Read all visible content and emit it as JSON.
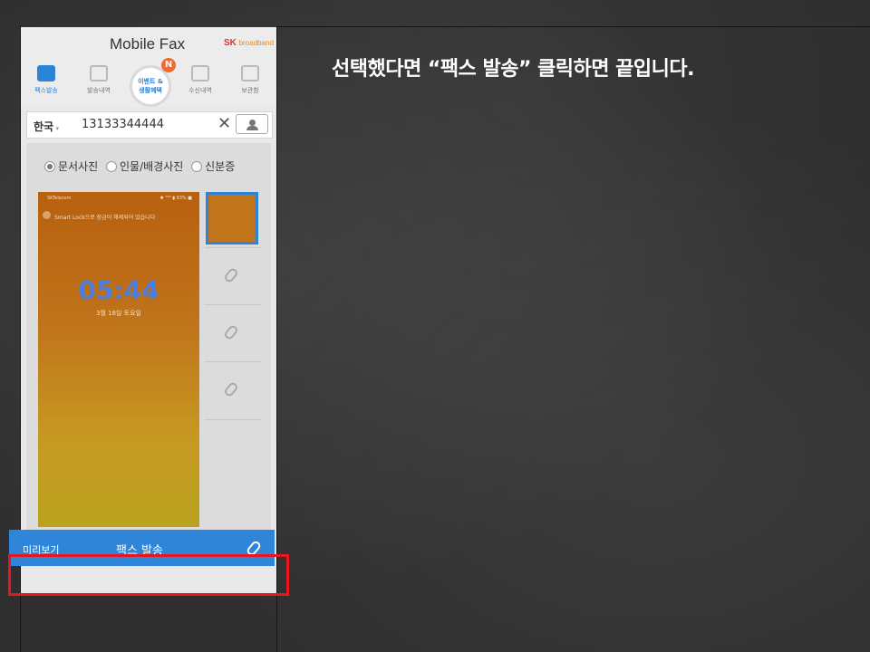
{
  "caption": "선택했다면 “팩스 발송” 클릭하면 끝입니다.",
  "app": {
    "title": "Mobile Fax",
    "brand": "SK",
    "brand_sub": "broadband"
  },
  "nav": [
    {
      "label": "팩스발송",
      "icon": "fax-printer-icon",
      "active": true
    },
    {
      "label": "발송내역",
      "icon": "send-history-icon",
      "active": false
    },
    {
      "label": "수신내역",
      "icon": "receive-history-icon",
      "active": false
    },
    {
      "label": "보관함",
      "icon": "storage-box-icon",
      "active": false
    }
  ],
  "event": {
    "line1": "이벤트 &",
    "line2": "생활혜택",
    "badge": "N"
  },
  "recipient": {
    "country": "한국",
    "number": "13133344444",
    "clear": "✕"
  },
  "photo_types": [
    {
      "label": "문서사진",
      "selected": true
    },
    {
      "label": "인물/배경사진",
      "selected": false
    },
    {
      "label": "신분증",
      "selected": false
    }
  ],
  "preview_image": {
    "carrier": "SKTelecom",
    "status_right": "✱ ᵀ⁴ᴳ ▮ 93% ■",
    "notice": "Smart Lock으로 잠금이 해제되어 있습니다",
    "time": "05:44",
    "date": "3월 18일 토요일"
  },
  "bottom_bar": {
    "preview_label": "미리보기",
    "send_label": "팩스 발송"
  },
  "colors": {
    "accent": "#2f86d9",
    "highlight": "#e8161e",
    "badge": "#ee6a2e"
  }
}
